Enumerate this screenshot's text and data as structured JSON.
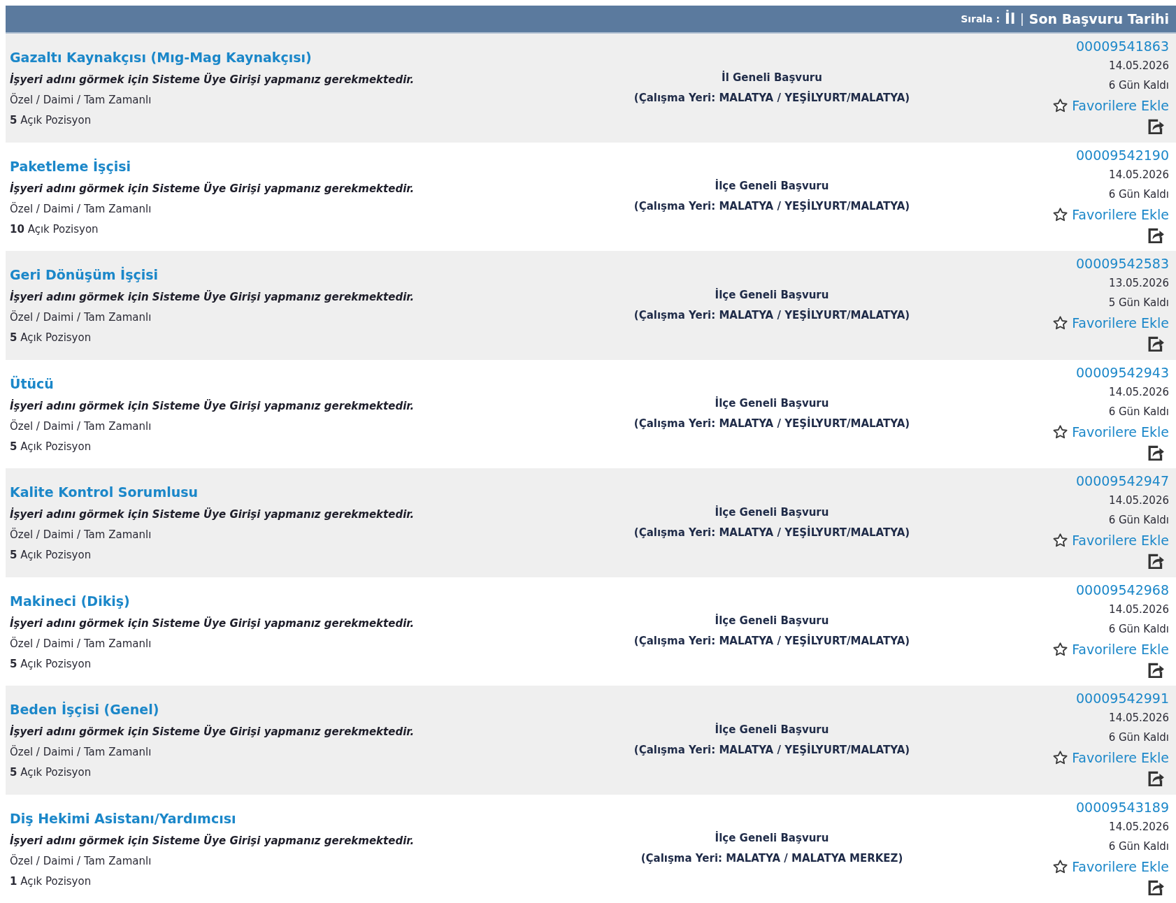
{
  "sort_bar": {
    "label": "Sırala :",
    "separator": "|",
    "options": [
      {
        "label": "İl"
      },
      {
        "label": "Son Başvuru Tarihi"
      }
    ]
  },
  "listings": [
    {
      "title": "Gazaltı Kaynakçısı (Mıg-Mag Kaynakçısı)",
      "notice": "İşyeri adını görmek için Sisteme Üye Girişi yapmanız gerekmektedir.",
      "employment_type": "Özel / Daimi / Tam Zamanlı",
      "open_positions": "**5** Açık Pozisyon",
      "scope": "İl Geneli Başvuru",
      "workplace": "(Çalışma Yeri: MALATYA / YEŞİLYURT/MALATYA)",
      "number": "00009541863",
      "deadline": "14.05.2026",
      "days_left": "6 Gün Kaldı",
      "favorite_label": "Favorilere Ekle"
    },
    {
      "title": "Paketleme İşçisi",
      "notice": "İşyeri adını görmek için Sisteme Üye Girişi yapmanız gerekmektedir.",
      "employment_type": "Özel / Daimi / Tam Zamanlı",
      "open_positions": "**10** Açık Pozisyon",
      "scope": "İlçe Geneli Başvuru",
      "workplace": "(Çalışma Yeri: MALATYA / YEŞİLYURT/MALATYA)",
      "number": "00009542190",
      "deadline": "14.05.2026",
      "days_left": "6 Gün Kaldı",
      "favorite_label": "Favorilere Ekle"
    },
    {
      "title": "Geri Dönüşüm İşçisi",
      "notice": "İşyeri adını görmek için Sisteme Üye Girişi yapmanız gerekmektedir.",
      "employment_type": "Özel / Daimi / Tam Zamanlı",
      "open_positions": "**5** Açık Pozisyon",
      "scope": "İlçe Geneli Başvuru",
      "workplace": "(Çalışma Yeri: MALATYA / YEŞİLYURT/MALATYA)",
      "number": "00009542583",
      "deadline": "13.05.2026",
      "days_left": "5 Gün Kaldı",
      "favorite_label": "Favorilere Ekle"
    },
    {
      "title": "Ütücü",
      "notice": "İşyeri adını görmek için Sisteme Üye Girişi yapmanız gerekmektedir.",
      "employment_type": "Özel / Daimi / Tam Zamanlı",
      "open_positions": "**5** Açık Pozisyon",
      "scope": "İlçe Geneli Başvuru",
      "workplace": "(Çalışma Yeri: MALATYA / YEŞİLYURT/MALATYA)",
      "number": "00009542943",
      "deadline": "14.05.2026",
      "days_left": "6 Gün Kaldı",
      "favorite_label": "Favorilere Ekle"
    },
    {
      "title": "Kalite Kontrol Sorumlusu",
      "notice": "İşyeri adını görmek için Sisteme Üye Girişi yapmanız gerekmektedir.",
      "employment_type": "Özel / Daimi / Tam Zamanlı",
      "open_positions": "**5** Açık Pozisyon",
      "scope": "İlçe Geneli Başvuru",
      "workplace": "(Çalışma Yeri: MALATYA / YEŞİLYURT/MALATYA)",
      "number": "00009542947",
      "deadline": "14.05.2026",
      "days_left": "6 Gün Kaldı",
      "favorite_label": "Favorilere Ekle"
    },
    {
      "title": "Makineci (Dikiş)",
      "notice": "İşyeri adını görmek için Sisteme Üye Girişi yapmanız gerekmektedir.",
      "employment_type": "Özel / Daimi / Tam Zamanlı",
      "open_positions": "**5** Açık Pozisyon",
      "scope": "İlçe Geneli Başvuru",
      "workplace": "(Çalışma Yeri: MALATYA / YEŞİLYURT/MALATYA)",
      "number": "00009542968",
      "deadline": "14.05.2026",
      "days_left": "6 Gün Kaldı",
      "favorite_label": "Favorilere Ekle"
    },
    {
      "title": "Beden İşçisi (Genel)",
      "notice": "İşyeri adını görmek için Sisteme Üye Girişi yapmanız gerekmektedir.",
      "employment_type": "Özel / Daimi / Tam Zamanlı",
      "open_positions": "**5** Açık Pozisyon",
      "scope": "İlçe Geneli Başvuru",
      "workplace": "(Çalışma Yeri: MALATYA / YEŞİLYURT/MALATYA)",
      "number": "00009542991",
      "deadline": "14.05.2026",
      "days_left": "6 Gün Kaldı",
      "favorite_label": "Favorilere Ekle"
    },
    {
      "title": "Diş Hekimi Asistanı/Yardımcısı",
      "notice": "İşyeri adını görmek için Sisteme Üye Girişi yapmanız gerekmektedir.",
      "employment_type": "Özel / Daimi / Tam Zamanlı",
      "open_positions": "**1** Açık Pozisyon",
      "scope": "İlçe Geneli Başvuru",
      "workplace": "(Çalışma Yeri: MALATYA / MALATYA MERKEZ)",
      "number": "00009543189",
      "deadline": "14.05.2026",
      "days_left": "6 Gün Kaldı",
      "favorite_label": "Favorilere Ekle"
    }
  ]
}
